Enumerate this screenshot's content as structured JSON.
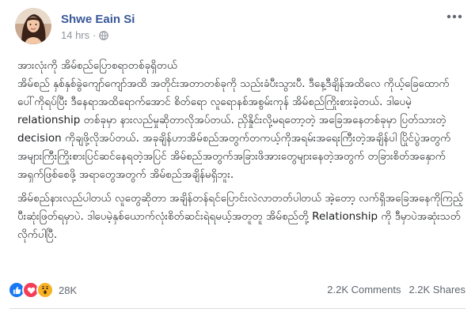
{
  "post": {
    "author": "Shwe Eain Si",
    "time": "14 hrs",
    "separator": "·",
    "privacy_icon": "globe-icon",
    "more_icon": "more-dots-icon",
    "paragraphs": [
      "အားလုံးကို အိမ်စည်ပြောစရာတစ်ခုရှိတယ်\nအိမ်စည် နှစ်နှစ်ခွဲကျော်ကျော်အထိ အတိုင်းအတာတစ်ခုကို သည်းခံပီးသွားပီ. ဒီနေ့ဒီချိန်အထိလေ ကိုယ့်ခြေထောက်ပေါ်ကိုရပ်ပြီး ဒီနေရာအထိရောက်အောင် စိတ်ရော လူရောနစ်အစွမ်းကုန် အိမ်စည်ကြိုးစားခဲ့တယ်. ဒါပေမဲ့ relationship တစ်ခုမှာ နားလည်မှုဆိုတာလိုအပ်တယ်. ညှိနှိုင်းလို့မရတော့တဲ့ အခြေအနေတစ်ခုမှာ ပြတ်သားတဲ့ decision ကိုချဖို့လိုအပ်တယ်. အခုချိန်ဟာအိမ်စည်အတွက်တကယ့်ကိုအရမ်းအရေးကြီးတဲ့အချိန်ပါ ပြိုင်ပွဲအတွက်အများကြီးကြိုးစားပြင်ဆင်နေရတဲ့အပြင် အိမ်စည်အတွက်အခြားဖိအားတွေများနေတဲ့အတွက် တခြားစိတ်အနှောက်အရှက်ဖြစ်စေဖို့ အရာတွေအတွက် အိမ်စည်အချိန်မရှိဘူး.",
      "အိမ်စည်နားလည်ပါတယ် လူတွေဆိုတာ အချိန်တန်ရင်ပြောင်းလဲလာတတ်ပါတယ် အဲ့တော့ လက်ရှိအခြေအနေကိုကြည့်ပီးဆုံးဖြတ်ရမှာပဲ. ဒါပေမဲ့နှစ်ယောက်လုံးစိတ်ဆင်းရဲရမယ့်အတူတူ အိမ်စည်တို့ Relationship ကို ဒီမှာပဲအဆုံးသတ်လိုက်ပါပြီ."
    ],
    "reactions": {
      "icons": [
        "like-icon",
        "love-icon",
        "wow-icon"
      ],
      "count": "28K"
    },
    "comments": "2.2K Comments",
    "shares": "2.2K Shares",
    "colors": {
      "author_link": "#385898",
      "like": "#1877f2",
      "love": "#f33e58",
      "wow": "#f7b125",
      "meta": "#90949c"
    }
  }
}
